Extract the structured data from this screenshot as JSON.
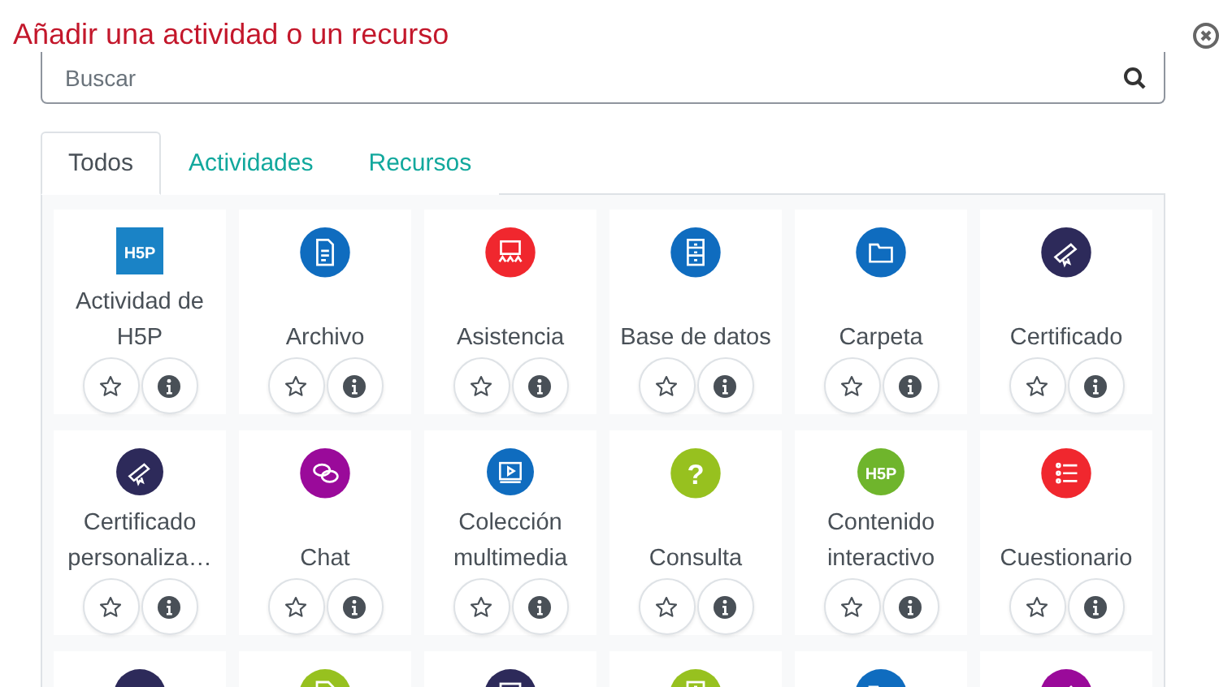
{
  "dialog": {
    "title": "Añadir una actividad o un recurso"
  },
  "search": {
    "placeholder": "Buscar"
  },
  "tabs": [
    {
      "label": "Todos",
      "selected": true
    },
    {
      "label": "Actividades",
      "selected": false
    },
    {
      "label": "Recursos",
      "selected": false
    }
  ],
  "items": [
    {
      "label": "Actividad de H5P",
      "kind": "square",
      "color": "#1a83c6",
      "badge": "H5P",
      "starred": false
    },
    {
      "label": "Archivo",
      "kind": "circle",
      "color": "#0f6cbf",
      "starred": false
    },
    {
      "label": "Asistencia",
      "kind": "circle",
      "color": "#f0272e",
      "starred": false
    },
    {
      "label": "Base de datos",
      "kind": "circle",
      "color": "#0f6cbf",
      "starred": false
    },
    {
      "label": "Carpeta",
      "kind": "circle",
      "color": "#0f6cbf",
      "starred": false
    },
    {
      "label": "Certificado",
      "kind": "circle",
      "color": "#2d2a5a",
      "starred": false
    },
    {
      "label": "Certificado personaliza…",
      "kind": "circle",
      "color": "#2d2a5a",
      "starred": false
    },
    {
      "label": "Chat",
      "kind": "circle",
      "color": "#9a0a9a",
      "starred": false
    },
    {
      "label": "Colección multimedia",
      "kind": "circle",
      "color": "#0f6cbf",
      "starred": false
    },
    {
      "label": "Consulta",
      "kind": "circle",
      "color": "#97c11f",
      "badge": "?",
      "starred": false
    },
    {
      "label": "Contenido interactivo",
      "kind": "circle",
      "color": "#6fb52c",
      "badge": "H5P",
      "starred": false
    },
    {
      "label": "Cuestionario",
      "kind": "circle",
      "color": "#f0272e",
      "starred": false
    },
    {
      "kind": "circle",
      "color": "#2d2a5a"
    },
    {
      "kind": "circle",
      "color": "#97c11f"
    },
    {
      "kind": "circle",
      "color": "#2d2a5a"
    },
    {
      "kind": "circle",
      "color": "#97c11f"
    },
    {
      "kind": "circle",
      "color": "#0f6cbf"
    },
    {
      "kind": "circle",
      "color": "#9a0a9a"
    }
  ]
}
